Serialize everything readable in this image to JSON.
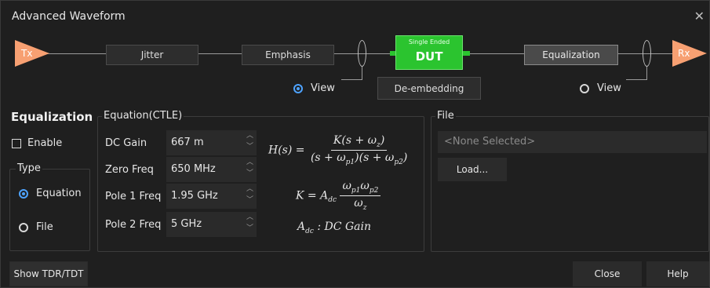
{
  "window": {
    "title": "Advanced Waveform"
  },
  "flow": {
    "tx_label": "Tx",
    "rx_label": "Rx",
    "jitter_label": "Jitter",
    "emphasis_label": "Emphasis",
    "dut_sub_label": "Single Ended",
    "dut_label": "DUT",
    "deembedding_label": "De-embedding",
    "equalization_label": "Equalization",
    "view_left_label": "View",
    "view_right_label": "View",
    "view_left_selected": true,
    "view_right_selected": false,
    "colors": {
      "tx_rx": "#f7a072",
      "dut": "#2bc42f",
      "radio_on": "#4ea3ff"
    }
  },
  "equalization": {
    "title": "Equalization",
    "enable_label": "Enable",
    "enable_checked": false,
    "type_group_label": "Type",
    "type_equation_label": "Equation",
    "type_file_label": "File",
    "selected_type": "Equation"
  },
  "ctle": {
    "group_label": "Equation(CTLE)",
    "dc_gain_label": "DC Gain",
    "dc_gain_value": "667 m",
    "zero_freq_label": "Zero Freq",
    "zero_freq_value": "650 MHz",
    "pole1_label": "Pole 1 Freq",
    "pole1_value": "1.95 GHz",
    "pole2_label": "Pole 2 Freq",
    "pole2_value": "5 GHz"
  },
  "file": {
    "group_label": "File",
    "placeholder": "<None Selected>",
    "load_label": "Load..."
  },
  "footer": {
    "show_tdr_label": "Show TDR/TDT",
    "close_label": "Close",
    "help_label": "Help"
  }
}
